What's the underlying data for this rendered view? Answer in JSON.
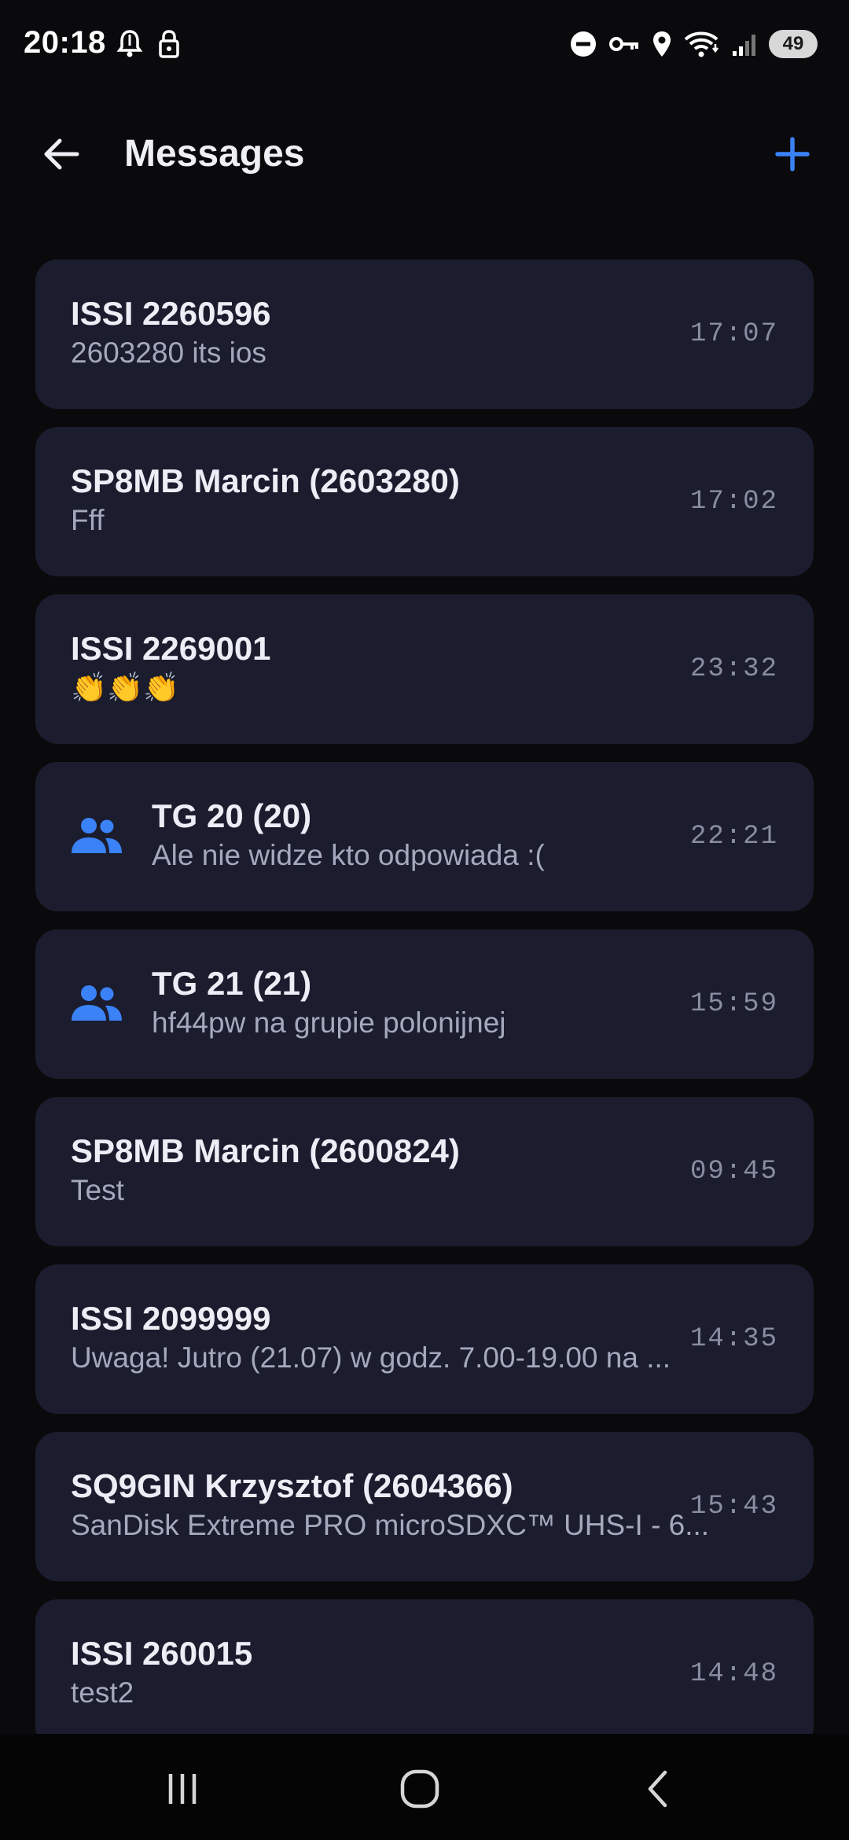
{
  "status_bar": {
    "time": "20:18",
    "battery": "49",
    "icons": [
      "notification-bell-icon",
      "lock-icon",
      "dnd-icon",
      "vpn-key-icon",
      "location-icon",
      "wifi-icon",
      "signal-icon",
      "battery-icon"
    ]
  },
  "app_bar": {
    "title": "Messages",
    "back_icon": "arrow-back-icon",
    "add_icon": "plus-icon",
    "accent_color": "#3b82f6"
  },
  "messages": [
    {
      "title": "ISSI 2260596",
      "preview": "2603280 its ios",
      "time": "17:07",
      "group": false
    },
    {
      "title": "SP8MB Marcin (2603280)",
      "preview": "Fff",
      "time": "17:02",
      "group": false
    },
    {
      "title": "ISSI 2269001",
      "preview": "👏👏👏",
      "time": "23:32",
      "group": false
    },
    {
      "title": "TG 20 (20)",
      "preview": "Ale nie widze kto odpowiada :(",
      "time": "22:21",
      "group": true
    },
    {
      "title": "TG 21 (21)",
      "preview": "hf44pw na grupie polonijnej",
      "time": "15:59",
      "group": true
    },
    {
      "title": "SP8MB Marcin (2600824)",
      "preview": "Test",
      "time": "09:45",
      "group": false
    },
    {
      "title": "ISSI 2099999",
      "preview": "Uwaga! Jutro (21.07) w godz. 7.00-19.00 na ...",
      "time": "14:35",
      "group": false
    },
    {
      "title": "SQ9GIN Krzysztof (2604366)",
      "preview": "SanDisk Extreme PRO microSDXC™ UHS-I - 6...",
      "time": "15:43",
      "group": false
    },
    {
      "title": "ISSI 260015",
      "preview": "test2",
      "time": "14:48",
      "group": false
    }
  ],
  "nav_bar": {
    "icons": [
      "recent-apps-icon",
      "home-icon",
      "back-nav-icon"
    ]
  }
}
